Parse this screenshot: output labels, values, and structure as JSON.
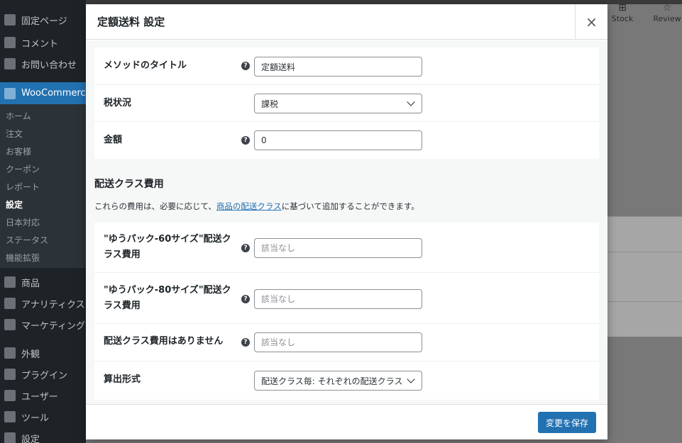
{
  "sidebar": {
    "items_top": [
      {
        "label": "固定ページ",
        "icon": "page-icon"
      },
      {
        "label": "コメント",
        "icon": "comment-icon"
      },
      {
        "label": "お問い合わせ",
        "icon": "mail-icon"
      },
      {
        "label": "WooCommerce",
        "icon": "woocommerce-icon"
      }
    ],
    "submenu": [
      "ホーム",
      "注文",
      "お客様",
      "クーポン",
      "レポート",
      "設定",
      "日本対応",
      "ステータス",
      "機能拡張"
    ],
    "items_bottom": [
      {
        "label": "商品",
        "icon": "product-icon"
      },
      {
        "label": "アナリティクス",
        "icon": "analytics-icon"
      },
      {
        "label": "マーケティング",
        "icon": "marketing-icon"
      },
      {
        "label": "外観",
        "icon": "appearance-icon"
      },
      {
        "label": "プラグイン",
        "icon": "plugin-icon"
      },
      {
        "label": "ユーザー",
        "icon": "user-icon"
      },
      {
        "label": "ツール",
        "icon": "tool-icon"
      },
      {
        "label": "設定",
        "icon": "settings-icon"
      }
    ]
  },
  "right_tabs": [
    {
      "label": "Stock",
      "icon": "stock-icon"
    },
    {
      "label": "Review",
      "icon": "star-icon"
    }
  ],
  "modal": {
    "title": "定額送料 設定",
    "close_label": "×",
    "fields": {
      "method_title": {
        "label": "メソッドのタイトル",
        "value": "定額送料"
      },
      "tax_status": {
        "label": "税状況",
        "value": "課税"
      },
      "cost": {
        "label": "金額",
        "value": "0"
      }
    },
    "section": {
      "heading": "配送クラス費用",
      "desc_before": "これらの費用は、必要に応じて、",
      "desc_link": "商品の配送クラス",
      "desc_after": "に基づいて追加することができます。"
    },
    "class_fields": {
      "yupack60": {
        "label": "\"ゆうパック-60サイズ\"配送クラス費用",
        "placeholder": "該当なし"
      },
      "yupack80": {
        "label": "\"ゆうパック-80サイズ\"配送クラス費用",
        "placeholder": "該当なし"
      },
      "no_class": {
        "label": "配送クラス費用はありません",
        "placeholder": "該当なし"
      },
      "calc_type": {
        "label": "算出形式",
        "value": "配送クラス毎: それぞれの配送クラスを個別に計算"
      }
    },
    "help_glyph": "?",
    "save_label": "変更を保存"
  },
  "colors": {
    "accent": "#2271b1",
    "sidebar_bg": "#1d2327",
    "overlay": "#787878"
  }
}
